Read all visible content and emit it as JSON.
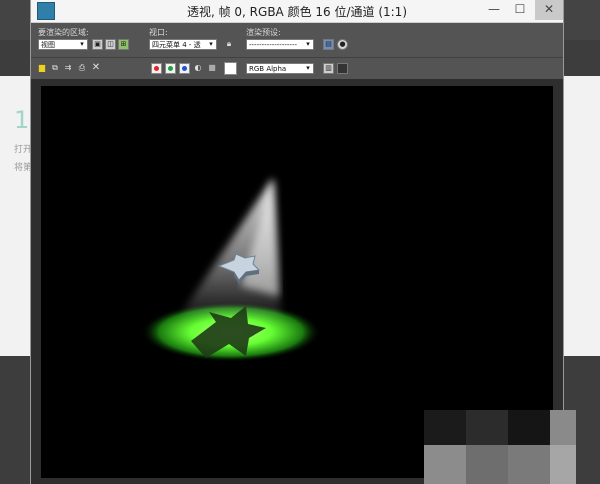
{
  "window": {
    "title": "透视, 帧 0, RGBA 颜色 16 位/通道 (1:1)",
    "controls": {
      "minimize": "—",
      "maximize": "☐",
      "close": "✕"
    }
  },
  "background_app": {
    "lines": [
      "1",
      "打开",
      "将第"
    ]
  },
  "toolbar": {
    "area_label": "要渲染的区域:",
    "area_value": "视图",
    "viewport_label": "视口:",
    "viewport_value": "四元菜单 4 - 透",
    "preset_label": "渲染预设:",
    "preset_value": "-------------------",
    "channel_value": "RGB Alpha"
  },
  "colors": {
    "red_channel": "#e8202a",
    "green_channel": "#1ea23a",
    "blue_channel": "#1e50d8",
    "spotlight_green": "#66ff33"
  },
  "icons": [
    "region-edit-icon",
    "region-crop-icon",
    "region-blowup-icon",
    "lock-icon",
    "render-setup-icon",
    "render-icon",
    "save-image-icon",
    "copy-image-icon",
    "clone-window-icon",
    "print-icon",
    "clear-icon",
    "monochrome-icon",
    "clear-display-icon",
    "display-toggle-icon"
  ]
}
